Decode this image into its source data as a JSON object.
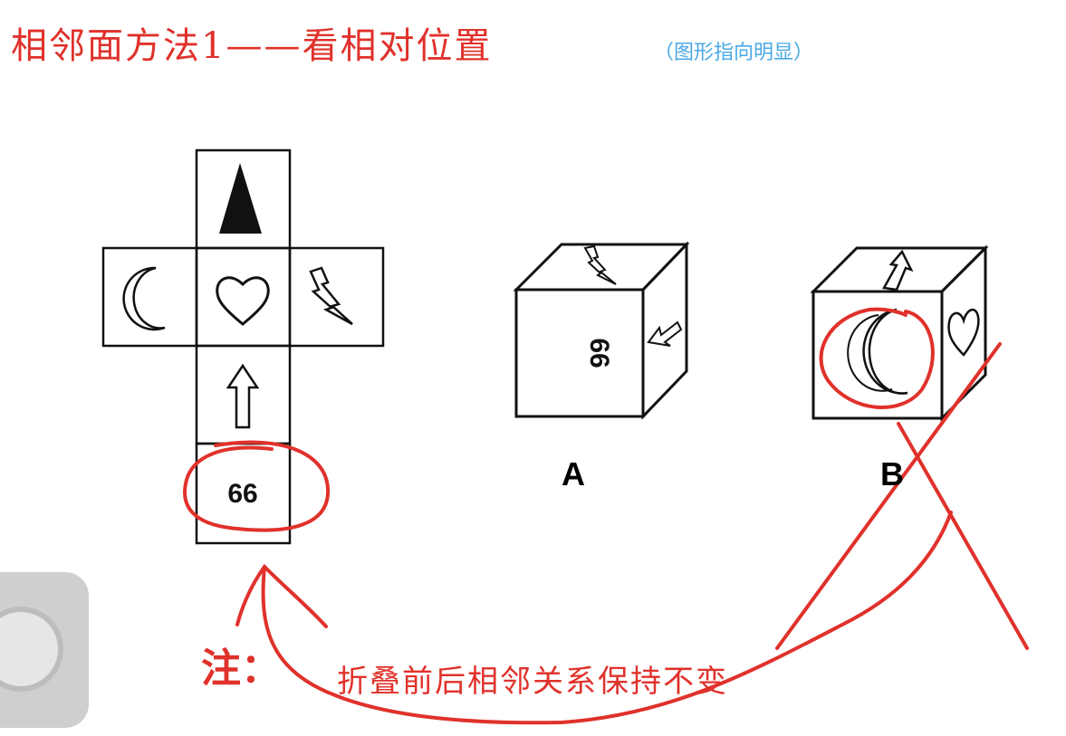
{
  "header": {
    "title": "相邻面方法1——看相对位置",
    "subtitle": "（图形指向明显）"
  },
  "net": {
    "faces": {
      "top": "black-triangle",
      "left": "crescent-moon",
      "center": "heart",
      "right": "lightning-bolt",
      "below_center": "up-arrow",
      "bottom": "66"
    },
    "bottom_text": "66"
  },
  "options": [
    {
      "label": "A",
      "front_text": "66",
      "top": "lightning-bolt",
      "right": "arrow"
    },
    {
      "label": "B",
      "front": "crescent-moon",
      "top": "arrow",
      "right": "heart"
    }
  ],
  "note": {
    "head": "注：",
    "body": "折叠前后相邻关系保持不变"
  },
  "colors": {
    "annotation": "#e0312b",
    "subtitle": "#4aa9e6",
    "ink": "#111111"
  }
}
